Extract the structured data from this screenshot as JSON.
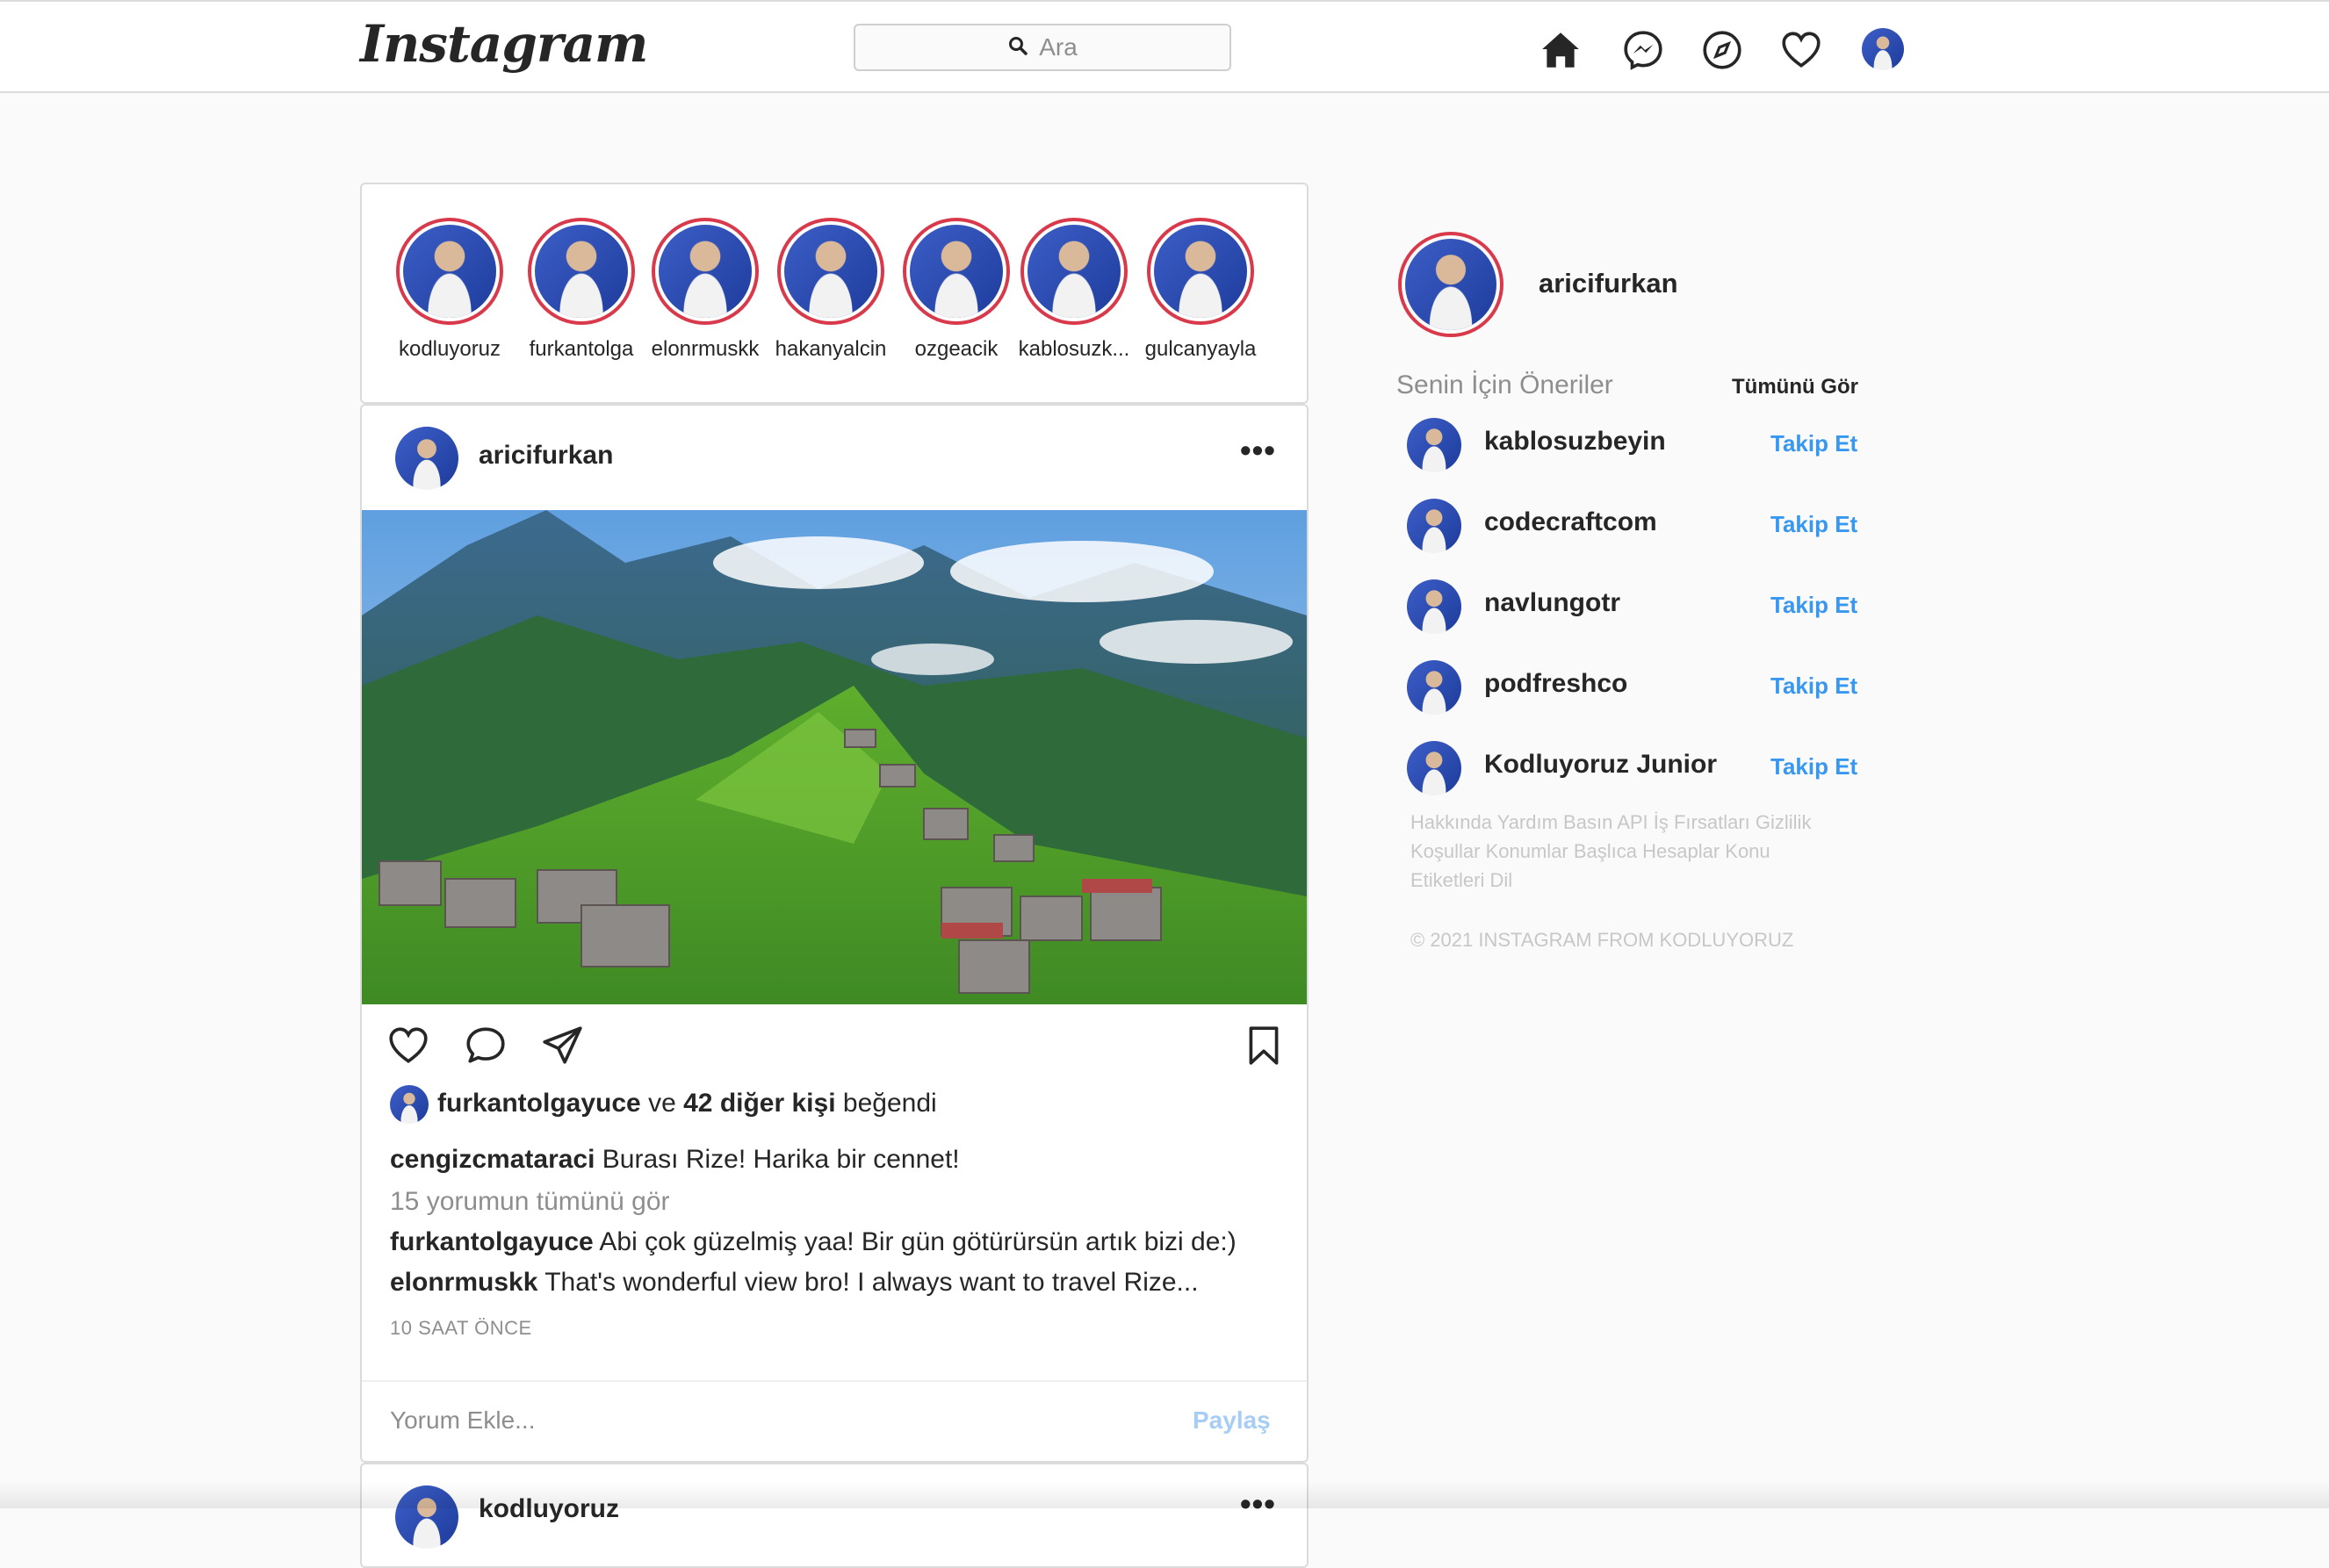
{
  "header": {
    "logo": "Instagram",
    "search_placeholder": "Ara",
    "icons": [
      "home-icon",
      "messenger-icon",
      "explore-icon",
      "heart-icon",
      "profile-avatar"
    ]
  },
  "stories": [
    {
      "name": "kodluyoruz"
    },
    {
      "name": "furkantolga"
    },
    {
      "name": "elonrmuskk"
    },
    {
      "name": "hakanyalcin"
    },
    {
      "name": "ozgeacik"
    },
    {
      "name": "kablosuzk..."
    },
    {
      "name": "gulcanyayla"
    }
  ],
  "post": {
    "username": "aricifurkan",
    "likes": {
      "user": "furkantolgayuce",
      "connector": "ve",
      "others": "42 diğer kişi",
      "suffix": "beğendi"
    },
    "caption": {
      "user": "cengizcmataraci",
      "text": "Burası Rize! Harika bir cennet!"
    },
    "view_all_comments": "15 yorumun tümünü gör",
    "comments": [
      {
        "user": "furkantolgayuce",
        "text": "Abi çok güzelmiş yaa! Bir gün götürürsün artık bizi de:)"
      },
      {
        "user": "elonrmuskk",
        "text": "That's wonderful view bro! I always want to travel Rize..."
      }
    ],
    "time": "10 SAAT ÖNCE",
    "comment_placeholder": "Yorum Ekle...",
    "share_label": "Paylaş"
  },
  "next_post": {
    "username": "kodluyoruz"
  },
  "sidebar": {
    "username": "aricifurkan",
    "suggestions_title": "Senin İçin Öneriler",
    "see_all": "Tümünü Gör",
    "suggestions": [
      {
        "name": "kablosuzbeyin",
        "action": "Takip Et"
      },
      {
        "name": "codecraftcom",
        "action": "Takip Et"
      },
      {
        "name": "navlungotr",
        "action": "Takip Et"
      },
      {
        "name": "podfreshco",
        "action": "Takip Et"
      },
      {
        "name": "Kodluyoruz Junior",
        "action": "Takip Et"
      }
    ],
    "footer_links": "Hakkında Yardım Basın API İş Fırsatları Gizlilik Koşullar Konumlar Başlıca Hesaplar Konu Etiketleri Dil",
    "copyright": "© 2021 INSTAGRAM FROM KODLUYORUZ"
  },
  "colors": {
    "background": "#fafafa",
    "story_ring": "#d83a4c",
    "follow_link": "#3897f0",
    "share_disabled": "#a8cdf5",
    "muted_text": "#8e8e8e"
  }
}
